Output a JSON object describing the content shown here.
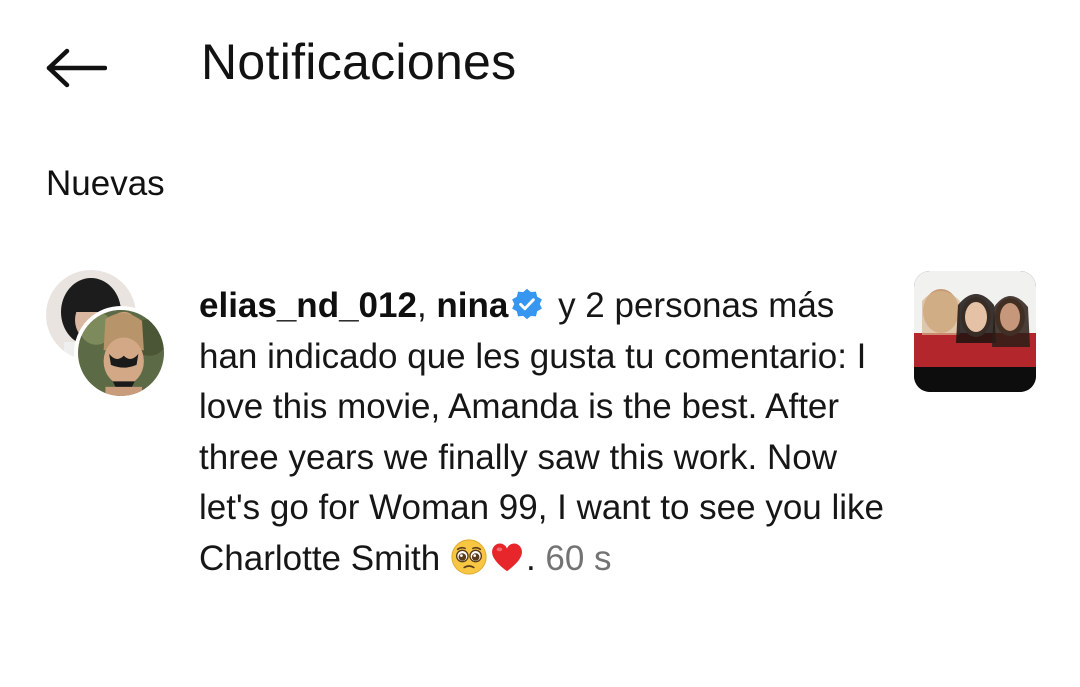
{
  "header": {
    "title": "Notificaciones",
    "back_icon": "arrow-left-icon"
  },
  "sections": [
    {
      "title": "Nuevas",
      "notifications": [
        {
          "user1": "elias_nd_012",
          "sep": ", ",
          "user2": "nina",
          "user2_verified": true,
          "text_before_comment": " y 2 personas más han indicado que les gusta tu comentario: ",
          "comment": "I love this movie, Amanda is the best. After three years we finally saw this work. Now let's go for Woman 99, I want to see you like Charlotte Smith ",
          "emojis": [
            "pleading-face-emoji",
            "red-heart-emoji"
          ],
          "after_emojis": ". ",
          "time": "60 s",
          "colors": {
            "verified": "#3797f0",
            "time": "#737373"
          }
        }
      ]
    }
  ]
}
